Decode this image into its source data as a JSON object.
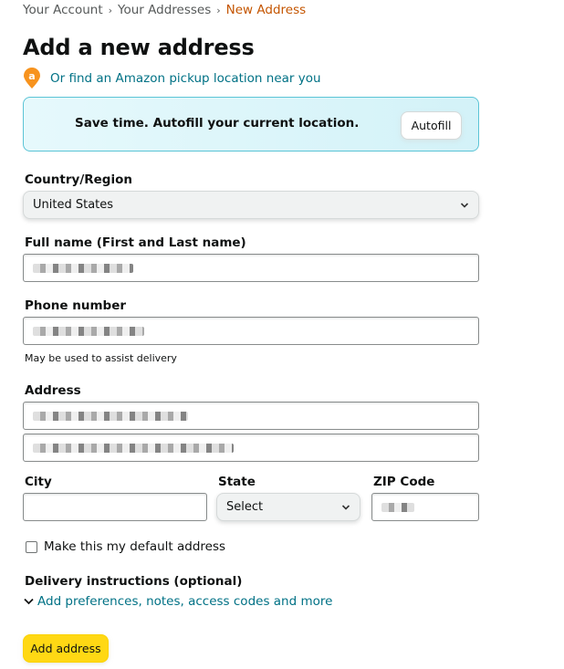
{
  "breadcrumb": {
    "items": [
      "Your Account",
      "Your Addresses",
      "New Address"
    ],
    "separator": "›"
  },
  "page": {
    "title": "Add a new address",
    "pickup_link": "Or find an Amazon pickup location near you",
    "pickup_icon_letter": "a"
  },
  "autofill": {
    "text": "Save time. Autofill your current location.",
    "button_label": "Autofill"
  },
  "form": {
    "country": {
      "label": "Country/Region",
      "value": "United States"
    },
    "full_name": {
      "label": "Full name (First and Last name)",
      "value": "[redacted]"
    },
    "phone": {
      "label": "Phone number",
      "value": "[redacted]",
      "hint": "May be used to assist delivery"
    },
    "address": {
      "label": "Address",
      "line1": "[redacted]",
      "line2": "[redacted]"
    },
    "city": {
      "label": "City",
      "value": ""
    },
    "state": {
      "label": "State",
      "value": "Select"
    },
    "zip": {
      "label": "ZIP Code",
      "value": "[redacted]"
    },
    "default_checkbox": {
      "label": "Make this my default address",
      "checked": false
    },
    "delivery": {
      "label": "Delivery instructions (optional)",
      "link": "Add preferences, notes, access codes and more"
    },
    "submit_label": "Add address"
  },
  "colors": {
    "link": "#007185",
    "breadcrumb_current": "#c45500",
    "primary_button": "#ffd814",
    "pin": "#f7931e"
  }
}
